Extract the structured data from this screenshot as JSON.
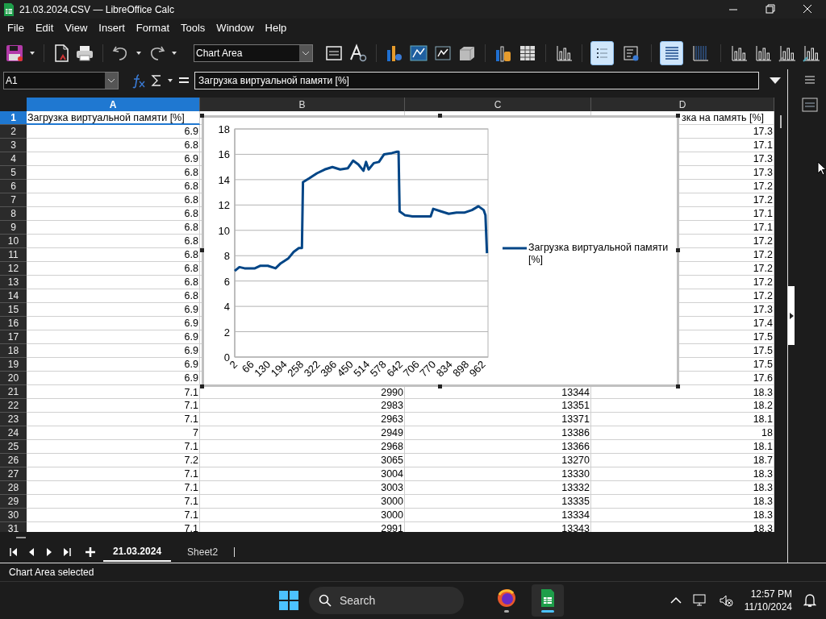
{
  "window": {
    "title": "21.03.2024.CSV — LibreOffice Calc"
  },
  "menu": [
    "File",
    "Edit",
    "View",
    "Insert",
    "Format",
    "Tools",
    "Window",
    "Help"
  ],
  "toolbar": {
    "element_selector": "Chart Area",
    "toggles": [
      {
        "kind": "legend",
        "on": true
      },
      {
        "kind": "legend-format",
        "on": false
      },
      {
        "kind": "grid-horizontal",
        "on": true
      },
      {
        "kind": "grid-vertical",
        "on": false
      }
    ]
  },
  "formula_bar": {
    "name_box": "A1",
    "content": "Загрузка виртуальной памяти [%]"
  },
  "sheet": {
    "columns": [
      {
        "label": "A",
        "selected": true
      },
      {
        "label": "B",
        "selected": false
      },
      {
        "label": "C",
        "selected": false
      },
      {
        "label": "D",
        "selected": false
      }
    ],
    "rows": [
      {
        "label": "1",
        "selected": true,
        "cells": [
          "Загрузка виртуальной памяти [%]",
          null,
          null,
          "зка на память [%]"
        ]
      },
      {
        "label": "2",
        "selected": false,
        "cells": [
          "6.9",
          null,
          null,
          "17.3"
        ]
      },
      {
        "label": "3",
        "selected": false,
        "cells": [
          "6.8",
          null,
          null,
          "17.1"
        ]
      },
      {
        "label": "4",
        "selected": false,
        "cells": [
          "6.9",
          null,
          null,
          "17.3"
        ]
      },
      {
        "label": "5",
        "selected": false,
        "cells": [
          "6.8",
          null,
          null,
          "17.3"
        ]
      },
      {
        "label": "6",
        "selected": false,
        "cells": [
          "6.8",
          null,
          null,
          "17.2"
        ]
      },
      {
        "label": "7",
        "selected": false,
        "cells": [
          "6.8",
          null,
          null,
          "17.2"
        ]
      },
      {
        "label": "8",
        "selected": false,
        "cells": [
          "6.8",
          null,
          null,
          "17.1"
        ]
      },
      {
        "label": "9",
        "selected": false,
        "cells": [
          "6.8",
          null,
          null,
          "17.1"
        ]
      },
      {
        "label": "10",
        "selected": false,
        "cells": [
          "6.8",
          null,
          null,
          "17.2"
        ]
      },
      {
        "label": "11",
        "selected": false,
        "cells": [
          "6.8",
          null,
          null,
          "17.2"
        ]
      },
      {
        "label": "12",
        "selected": false,
        "cells": [
          "6.8",
          null,
          null,
          "17.2"
        ]
      },
      {
        "label": "13",
        "selected": false,
        "cells": [
          "6.8",
          null,
          null,
          "17.2"
        ]
      },
      {
        "label": "14",
        "selected": false,
        "cells": [
          "6.8",
          null,
          null,
          "17.2"
        ]
      },
      {
        "label": "15",
        "selected": false,
        "cells": [
          "6.9",
          null,
          null,
          "17.3"
        ]
      },
      {
        "label": "16",
        "selected": false,
        "cells": [
          "6.9",
          null,
          null,
          "17.4"
        ]
      },
      {
        "label": "17",
        "selected": false,
        "cells": [
          "6.9",
          null,
          null,
          "17.5"
        ]
      },
      {
        "label": "18",
        "selected": false,
        "cells": [
          "6.9",
          null,
          null,
          "17.5"
        ]
      },
      {
        "label": "19",
        "selected": false,
        "cells": [
          "6.9",
          null,
          null,
          "17.5"
        ]
      },
      {
        "label": "20",
        "selected": false,
        "cells": [
          "6.9",
          null,
          null,
          "17.6"
        ]
      },
      {
        "label": "21",
        "selected": false,
        "cells": [
          "7.1",
          "2990",
          "13344",
          "18.3"
        ]
      },
      {
        "label": "22",
        "selected": false,
        "cells": [
          "7.1",
          "2983",
          "13351",
          "18.2"
        ]
      },
      {
        "label": "23",
        "selected": false,
        "cells": [
          "7.1",
          "2963",
          "13371",
          "18.1"
        ]
      },
      {
        "label": "24",
        "selected": false,
        "cells": [
          "7",
          "2949",
          "13386",
          "18"
        ]
      },
      {
        "label": "25",
        "selected": false,
        "cells": [
          "7.1",
          "2968",
          "13366",
          "18.1"
        ]
      },
      {
        "label": "26",
        "selected": false,
        "cells": [
          "7.2",
          "3065",
          "13270",
          "18.7"
        ]
      },
      {
        "label": "27",
        "selected": false,
        "cells": [
          "7.1",
          "3004",
          "13330",
          "18.3"
        ]
      },
      {
        "label": "28",
        "selected": false,
        "cells": [
          "7.1",
          "3003",
          "13332",
          "18.3"
        ]
      },
      {
        "label": "29",
        "selected": false,
        "cells": [
          "7.1",
          "3000",
          "13335",
          "18.3"
        ]
      },
      {
        "label": "30",
        "selected": false,
        "cells": [
          "7.1",
          "3000",
          "13334",
          "18.3"
        ]
      },
      {
        "label": "31",
        "selected": false,
        "cells": [
          "7.1",
          "2991",
          "13343",
          "18.3"
        ]
      }
    ],
    "chart_data": {
      "type": "line",
      "grid": true,
      "xlim": [
        2,
        982
      ],
      "ylim": [
        0,
        18
      ],
      "xticks": [
        2,
        66,
        130,
        194,
        258,
        322,
        386,
        450,
        514,
        578,
        642,
        706,
        770,
        834,
        898,
        962
      ],
      "yticks": [
        0,
        2,
        4,
        6,
        8,
        10,
        12,
        14,
        16,
        18
      ],
      "x": [
        2,
        20,
        40,
        60,
        80,
        100,
        130,
        160,
        180,
        210,
        230,
        250,
        262,
        266,
        290,
        320,
        350,
        380,
        410,
        440,
        460,
        480,
        500,
        510,
        520,
        540,
        560,
        580,
        610,
        630,
        636,
        640,
        660,
        690,
        730,
        760,
        770,
        800,
        830,
        860,
        890,
        920,
        945,
        965,
        972,
        978
      ],
      "series": [
        {
          "name": "Загрузка виртуальной памяти [%]",
          "color": "#004586",
          "values": [
            6.8,
            7.1,
            7.0,
            7.0,
            7.0,
            7.2,
            7.2,
            7.0,
            7.4,
            7.8,
            8.3,
            8.6,
            8.6,
            13.8,
            14.1,
            14.5,
            14.8,
            15.0,
            14.8,
            14.9,
            15.5,
            15.2,
            14.7,
            15.4,
            14.8,
            15.3,
            15.4,
            16.0,
            16.1,
            16.2,
            16.2,
            11.5,
            11.2,
            11.1,
            11.1,
            11.1,
            11.7,
            11.5,
            11.3,
            11.4,
            11.4,
            11.6,
            11.9,
            11.6,
            11.2,
            8.2
          ]
        }
      ]
    }
  },
  "sheet_tabs": [
    {
      "label": "21.03.2024",
      "selected": true
    },
    {
      "label": "Sheet2",
      "selected": false
    }
  ],
  "status_bar": "Chart Area selected",
  "taskbar": {
    "search": {
      "placeholder": "Search"
    },
    "time": "12:57 PM",
    "date": "11/10/2024"
  }
}
